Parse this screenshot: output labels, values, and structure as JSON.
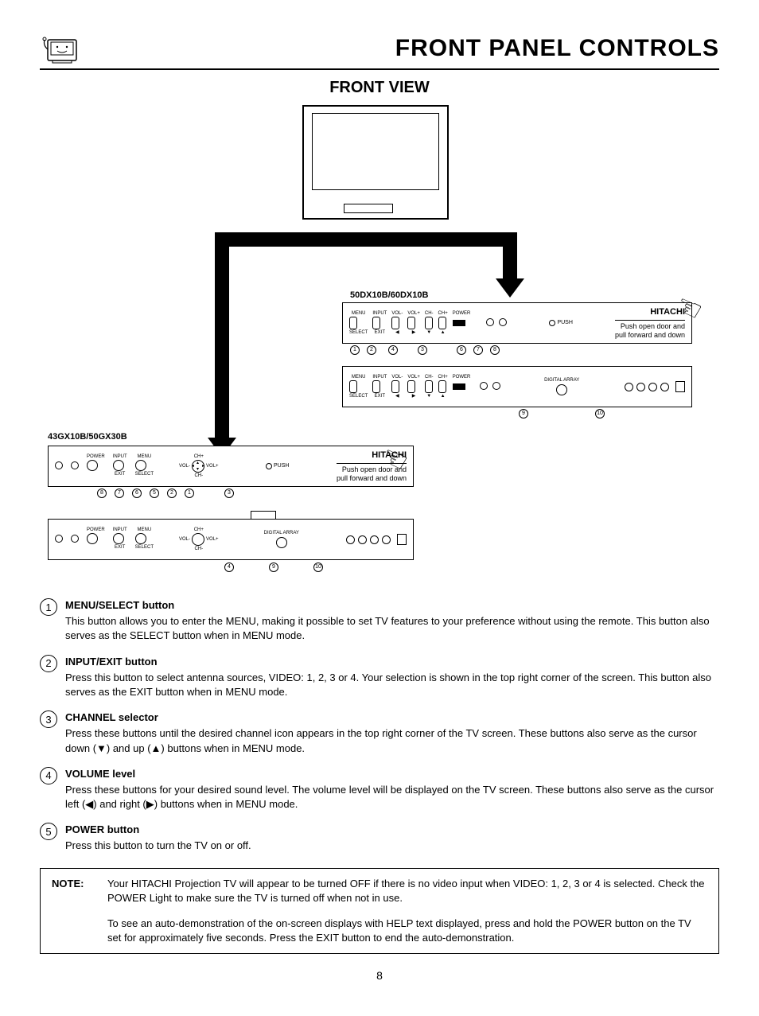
{
  "header": {
    "title": "FRONT PANEL CONTROLS",
    "subtitle": "FRONT VIEW"
  },
  "diagram": {
    "model_top": "50DX10B/60DX10B",
    "model_bottom": "43GX10B/50GX30B",
    "brand": "HITACHI",
    "push_label": "PUSH",
    "door_note_1": "Push open door and",
    "door_note_2": "pull forward and down",
    "labels": {
      "menu": "MENU",
      "input": "INPUT",
      "vol_minus": "VOL-",
      "vol_plus": "VOL+",
      "ch_minus": "CH-",
      "ch_plus": "CH+",
      "power": "POWER",
      "select": "SELECT",
      "exit": "EXIT",
      "digital_array": "DIGITAL ARRAY"
    },
    "callouts_panel1": [
      "1",
      "2",
      "4",
      "3",
      "6",
      "7",
      "8"
    ],
    "callouts_panel1b": [
      "9",
      "10"
    ],
    "callouts_panel2": [
      "8",
      "7",
      "6",
      "5",
      "2",
      "1",
      "3"
    ],
    "callouts_panel2b": [
      "4",
      "9",
      "10"
    ]
  },
  "items": [
    {
      "num": "1",
      "title": "MENU/SELECT button",
      "body": "This button allows you to enter the MENU, making it possible to set TV features to your preference without using the remote.  This button also serves as the SELECT button when in MENU mode."
    },
    {
      "num": "2",
      "title": "INPUT/EXIT button",
      "body": "Press this button to select antenna sources, VIDEO: 1, 2, 3 or 4.  Your selection is shown in the top right corner of the screen.  This button also serves as the EXIT button when in MENU mode."
    },
    {
      "num": "3",
      "title": "CHANNEL selector",
      "body": "Press these buttons until the desired channel icon appears in the top right corner of the TV screen.  These buttons also serve as the cursor down (▼) and up (▲) buttons when in MENU mode."
    },
    {
      "num": "4",
      "title": "VOLUME level",
      "body": "Press these buttons for your desired sound level.  The volume level will be displayed on the TV screen.  These buttons also serve as the cursor left (◀) and right (▶) buttons when in MENU mode."
    },
    {
      "num": "5",
      "title": "POWER button",
      "body": "Press this button to turn the TV on or off."
    }
  ],
  "note": {
    "label": "NOTE:",
    "p1": "Your HITACHI Projection TV will appear to be turned OFF if there is no video input when VIDEO: 1, 2, 3 or 4 is selected.  Check the POWER Light to make sure the TV is turned off when not in use.",
    "p2": "To see an auto-demonstration of the on-screen displays with HELP text displayed, press and hold the POWER button on the TV set for approximately five seconds.  Press the EXIT button to end the auto-demonstration."
  },
  "page_number": "8"
}
